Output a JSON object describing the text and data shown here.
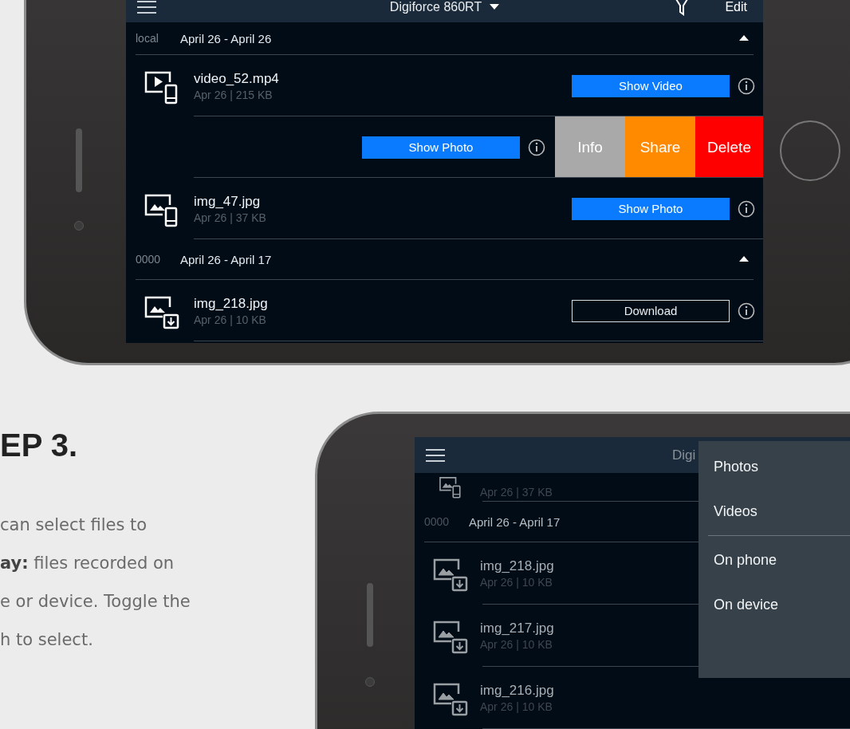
{
  "phones": [
    {
      "app_bar": {
        "title": "Digiforce 860RT",
        "action": "Edit"
      },
      "list": [
        {
          "kind": "section",
          "label": "local",
          "range": "April 26 - April 26",
          "expanded": true
        },
        {
          "kind": "video",
          "name": "video_52.mp4",
          "meta": "Apr 26 | 215 KB",
          "button": "Show Video"
        },
        {
          "kind": "swiped",
          "button": "Show Photo",
          "actions": [
            {
              "label": "Info",
              "color": "#a9a9a9"
            },
            {
              "label": "Share",
              "color": "#ff8a00"
            },
            {
              "label": "Delete",
              "color": "#ff0000"
            }
          ]
        },
        {
          "kind": "photo",
          "name": "img_47.jpg",
          "meta": "Apr 26 | 37 KB",
          "button": "Show Photo"
        },
        {
          "kind": "section",
          "label": "0000",
          "range": "April 26 - April 17",
          "expanded": true
        },
        {
          "kind": "download",
          "name": "img_218.jpg",
          "meta": "Apr 26 | 10 KB",
          "button": "Download"
        }
      ]
    },
    {
      "app_bar": {
        "title": "Digi"
      },
      "list": [
        {
          "kind": "partial",
          "meta": "Apr 26 | 37 KB"
        },
        {
          "kind": "section",
          "label": "0000",
          "range": "April 26 - April 17"
        },
        {
          "kind": "download",
          "name": "img_218.jpg",
          "meta": "Apr 26 | 10 KB"
        },
        {
          "kind": "download",
          "name": "img_217.jpg",
          "meta": "Apr 26 | 10 KB"
        },
        {
          "kind": "download",
          "name": "img_216.jpg",
          "meta": "Apr 26 | 10 KB"
        }
      ],
      "menu_groups": [
        [
          "Photos",
          "Videos"
        ],
        [
          "On phone",
          "On device"
        ]
      ]
    }
  ],
  "step": {
    "heading": "EP 3.",
    "lines": [
      "can select files to",
      "**ay:** files recorded on",
      "e or device. Toggle the",
      "h to select."
    ]
  }
}
